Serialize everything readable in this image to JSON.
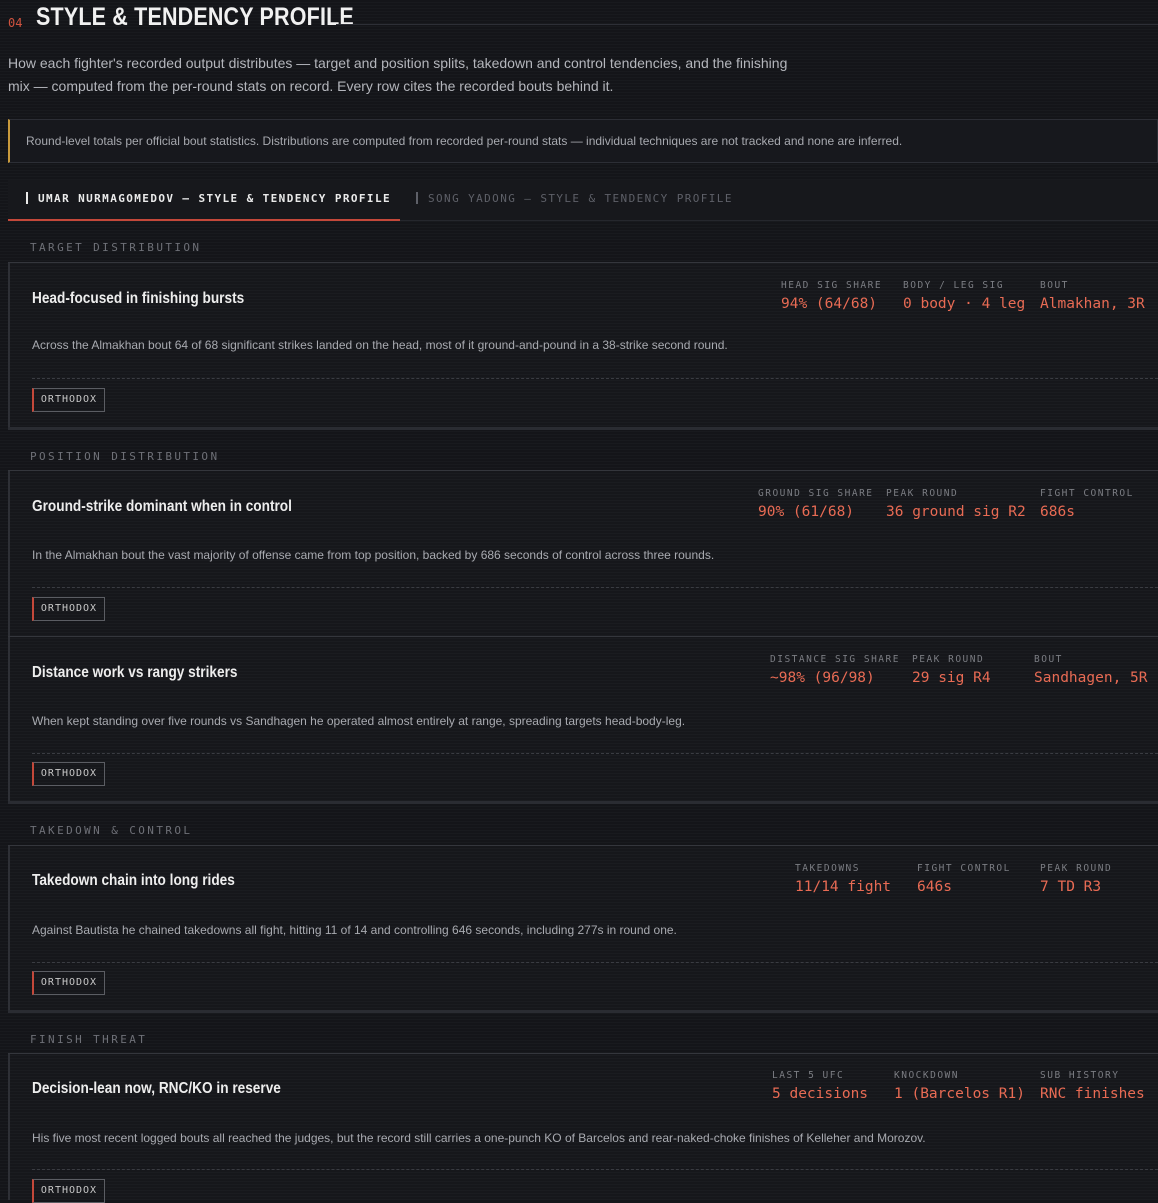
{
  "header": {
    "number": "04",
    "title": "STYLE & TENDENCY PROFILE"
  },
  "intro": "How each fighter's recorded output distributes — target and position splits, takedown and control tendencies, and the finishing mix — computed from the per-round stats on record. Every row cites the recorded bouts behind it.",
  "notice": "Round-level totals per official bout statistics. Distributions are computed from recorded per-round stats — individual techniques are not tracked and none are inferred.",
  "tabs": [
    {
      "label": "UMAR NURMAGOMEDOV — STYLE & TENDENCY PROFILE"
    },
    {
      "label": "SONG YADONG — STYLE & TENDENCY PROFILE"
    }
  ],
  "sections": {
    "target": "TARGET DISTRIBUTION",
    "position": "POSITION DISTRIBUTION",
    "takedown": "TAKEDOWN & CONTROL",
    "finish": "FINISH THREAT"
  },
  "cards": [
    {
      "title": "Head-focused in finishing bursts",
      "desc": "Across the Almakhan bout 64 of 68 significant strikes landed on the head, most of it ground-and-pound in a 38-strike second round.",
      "badge": "ORTHODOX",
      "stats": [
        {
          "label": "HEAD SIG SHARE",
          "value": "94% (64/68)"
        },
        {
          "label": "BODY / LEG SIG",
          "value": "0 body · 4 leg"
        },
        {
          "label": "BOUT",
          "value": "Almakhan, 3R"
        }
      ]
    },
    {
      "title": "Ground-strike dominant when in control",
      "desc": "In the Almakhan bout the vast majority of offense came from top position, backed by 686 seconds of control across three rounds.",
      "badge": "ORTHODOX",
      "stats": [
        {
          "label": "GROUND SIG SHARE",
          "value": "90% (61/68)"
        },
        {
          "label": "PEAK ROUND",
          "value": "36 ground sig R2"
        },
        {
          "label": "FIGHT CONTROL",
          "value": "686s"
        }
      ]
    },
    {
      "title": "Distance work vs rangy strikers",
      "desc": "When kept standing over five rounds vs Sandhagen he operated almost entirely at range, spreading targets head-body-leg.",
      "badge": "ORTHODOX",
      "stats": [
        {
          "label": "DISTANCE SIG SHARE",
          "value": "~98% (96/98)"
        },
        {
          "label": "PEAK ROUND",
          "value": "29 sig R4"
        },
        {
          "label": "BOUT",
          "value": "Sandhagen, 5R"
        }
      ]
    },
    {
      "title": "Takedown chain into long rides",
      "desc": "Against Bautista he chained takedowns all fight, hitting 11 of 14 and controlling 646 seconds, including 277s in round one.",
      "badge": "ORTHODOX",
      "stats": [
        {
          "label": "TAKEDOWNS",
          "value": "11/14 fight"
        },
        {
          "label": "FIGHT CONTROL",
          "value": "646s"
        },
        {
          "label": "PEAK ROUND",
          "value": "7 TD R3"
        }
      ]
    },
    {
      "title": "Decision-lean now, RNC/KO in reserve",
      "desc": "His five most recent logged bouts all reached the judges, but the record still carries a one-punch KO of Barcelos and rear-naked-choke finishes of Kelleher and Morozov.",
      "badge": "ORTHODOX",
      "stats": [
        {
          "label": "LAST 5 UFC",
          "value": "5 decisions"
        },
        {
          "label": "KNOCKDOWN",
          "value": "1 (Barcelos R1)"
        },
        {
          "label": "SUB HISTORY",
          "value": "RNC finishes"
        }
      ]
    }
  ],
  "colors": {
    "accent": "#e86b54",
    "notice_border": "#c99a3c",
    "active_tab": "#c4483a"
  }
}
